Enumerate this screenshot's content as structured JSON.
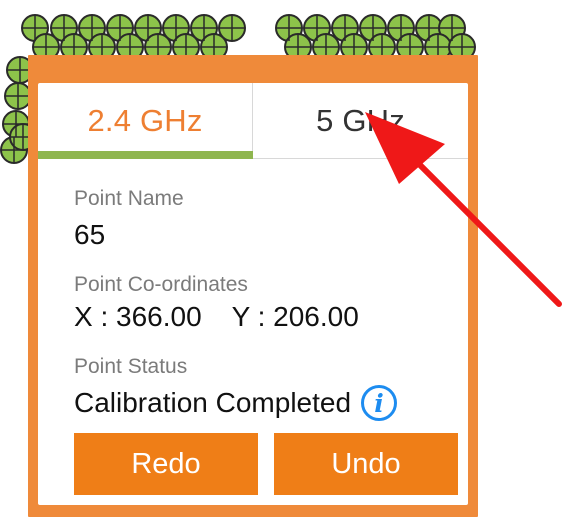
{
  "tabs": {
    "band_24": "2.4 GHz",
    "band_5": "5 GHz",
    "active": "2.4 GHz"
  },
  "point": {
    "name_label": "Point Name",
    "name_value": "65",
    "coords_label": "Point Co-ordinates",
    "x_text": "X : 366.00",
    "y_text": "Y : 206.00",
    "status_label": "Point Status",
    "status_value": "Calibration Completed"
  },
  "actions": {
    "redo": "Redo",
    "undo": "Undo"
  },
  "icons": {
    "info": "info-icon",
    "map_marker": "measurement-point-icon",
    "annotation_arrow": "red-arrow"
  },
  "colors": {
    "popup_orange": "#ef8a3a",
    "button_orange": "#ef7e17",
    "active_tab_text": "#ee7f32",
    "tab_indicator": "#8fb64f",
    "marker_green": "#8dc34a",
    "info_blue": "#1d8cf0",
    "annotation_red": "#ef1818"
  }
}
